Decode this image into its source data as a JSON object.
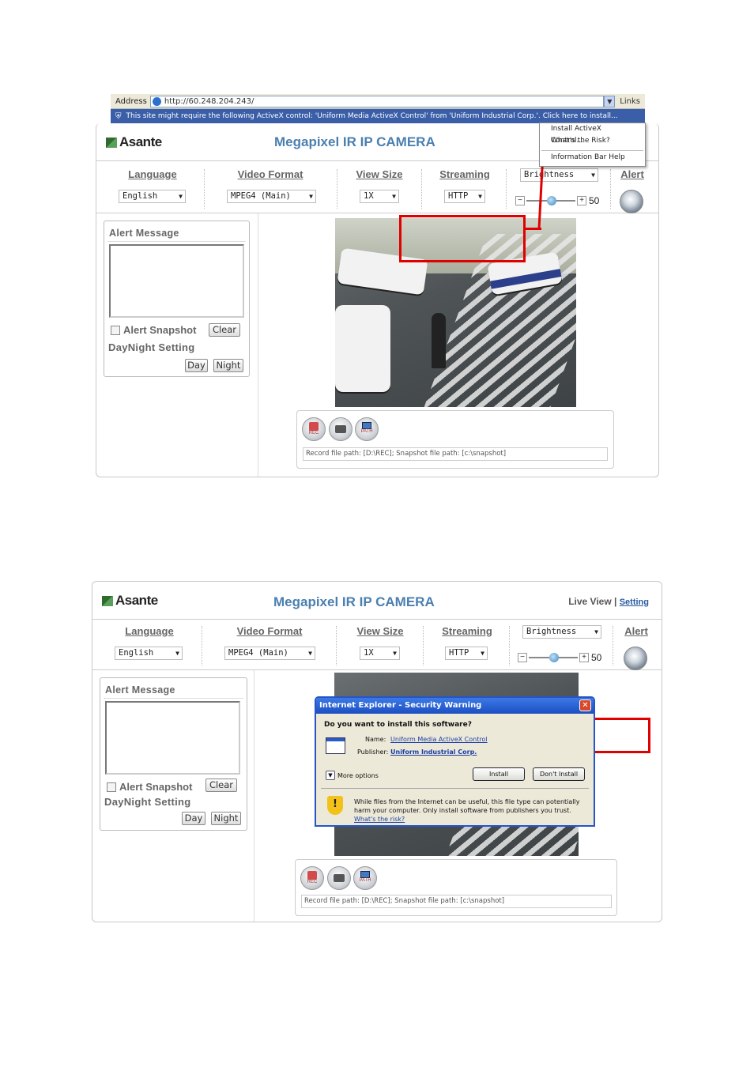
{
  "top": {
    "address_label": "Address",
    "url": "http://60.248.204.243/",
    "links_label": "Links",
    "info_bar_text": "This site might require the following ActiveX control: 'Uniform Media ActiveX Control' from 'Uniform Industrial Corp.'. Click here to install...",
    "context_menu": [
      "Install ActiveX Control...",
      "What's the Risk?",
      "Information Bar Help"
    ],
    "logo": "Asante",
    "title": "Megapixel IR IP CAMERA",
    "toolbar": {
      "language_label": "Language",
      "language_value": "English",
      "video_format_label": "Video Format",
      "video_format_value": "MPEG4 (Main)",
      "view_size_label": "View Size",
      "view_size_value": "1X",
      "streaming_label": "Streaming",
      "streaming_value": "HTTP",
      "brightness_value": "Brightness",
      "slider_minus": "−",
      "slider_plus": "+",
      "slider_value": "50",
      "alert_label": "Alert"
    },
    "sidebar": {
      "alert_message_title": "Alert Message",
      "alert_snapshot_label": "Alert Snapshot",
      "clear_label": "Clear",
      "daynight_label": "DayNight Setting",
      "day_label": "Day",
      "night_label": "Night"
    },
    "record_buttons": {
      "rec": "REC",
      "path": "PATH"
    },
    "path_text": "Record file path: [D:\\REC]; Snapshot file path: [c:\\snapshot]"
  },
  "bottom": {
    "logo": "Asante",
    "title": "Megapixel IR IP CAMERA",
    "live_view_label": "Live View",
    "separator": "|",
    "setting_label": "Setting",
    "toolbar": {
      "language_label": "Language",
      "language_value": "English",
      "video_format_label": "Video Format",
      "video_format_value": "MPEG4 (Main)",
      "view_size_label": "View Size",
      "view_size_value": "1X",
      "streaming_label": "Streaming",
      "streaming_value": "HTTP",
      "brightness_value": "Brightness",
      "slider_minus": "−",
      "slider_plus": "+",
      "slider_value": "50",
      "alert_label": "Alert"
    },
    "sidebar": {
      "alert_message_title": "Alert Message",
      "alert_snapshot_label": "Alert Snapshot",
      "clear_label": "Clear",
      "daynight_label": "DayNight Setting",
      "day_label": "Day",
      "night_label": "Night"
    },
    "record_buttons": {
      "rec": "REC",
      "path": "PATH"
    },
    "path_text": "Record file path: [D:\\REC]; Snapshot file path: [c:\\snapshot]",
    "dialog": {
      "title": "Internet Explorer - Security Warning",
      "close": "✕",
      "question": "Do you want to install this software?",
      "name_label": "Name:",
      "name_value": "Uniform Media ActiveX Control",
      "publisher_label": "Publisher:",
      "publisher_value": "Uniform Industrial Corp.",
      "more_options": "More options",
      "install": "Install",
      "dont_install": "Don't Install",
      "warning_text": "While files from the Internet can be useful, this file type can potentially harm your computer. Only install software from publishers you trust.",
      "risk_link": "What's the risk?"
    }
  },
  "colors": {
    "highlight": "#e00000",
    "title_blue": "#4a7fb0"
  }
}
